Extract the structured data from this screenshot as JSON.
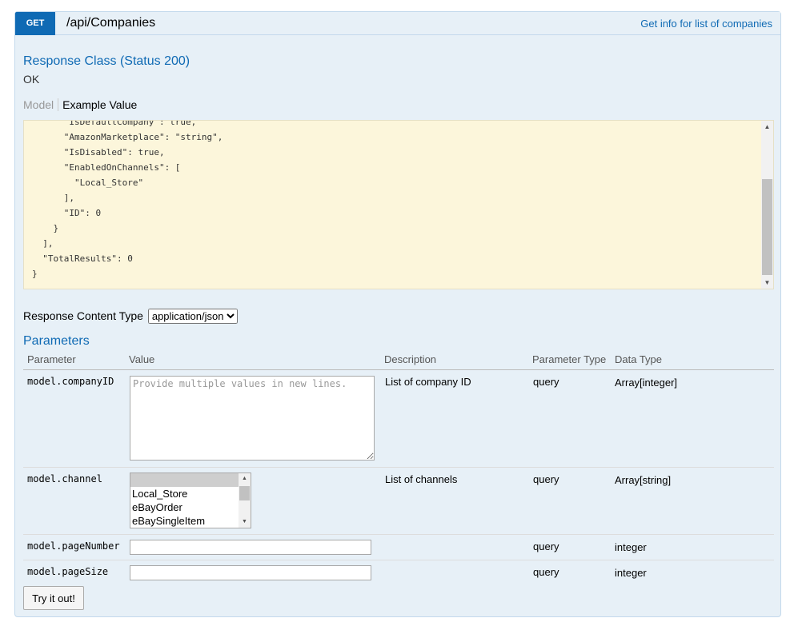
{
  "endpoint": {
    "method": "GET",
    "path": "/api/Companies",
    "summary": "Get info for list of companies"
  },
  "response_class": {
    "title": "Response Class (Status 200)",
    "status_text": "OK"
  },
  "tabs": {
    "model": "Model",
    "example": "Example Value"
  },
  "example_json": "      \"IsDefaultCompany\": true,\n      \"AmazonMarketplace\": \"string\",\n      \"IsDisabled\": true,\n      \"EnabledOnChannels\": [\n        \"Local_Store\"\n      ],\n      \"ID\": 0\n    }\n  ],\n  \"TotalResults\": 0\n}",
  "response_content_type": {
    "label": "Response Content Type",
    "selected": "application/json"
  },
  "parameters": {
    "title": "Parameters",
    "headers": [
      "Parameter",
      "Value",
      "Description",
      "Parameter Type",
      "Data Type"
    ],
    "rows": [
      {
        "name": "model.companyID",
        "placeholder": "Provide multiple values in new lines.",
        "description": "List of company ID",
        "param_type": "query",
        "data_type": "Array[integer]"
      },
      {
        "name": "model.channel",
        "options": [
          "",
          "Local_Store",
          "eBayOrder",
          "eBaySingleItem"
        ],
        "description": "List of channels",
        "param_type": "query",
        "data_type": "Array[string]"
      },
      {
        "name": "model.pageNumber",
        "description": "",
        "param_type": "query",
        "data_type": "integer"
      },
      {
        "name": "model.pageSize",
        "description": "",
        "param_type": "query",
        "data_type": "integer"
      }
    ]
  },
  "try_button": "Try it out!",
  "colors": {
    "accent": "#0f6ab4",
    "panel_bg": "#e7f0f7",
    "code_bg": "#fcf6db"
  }
}
